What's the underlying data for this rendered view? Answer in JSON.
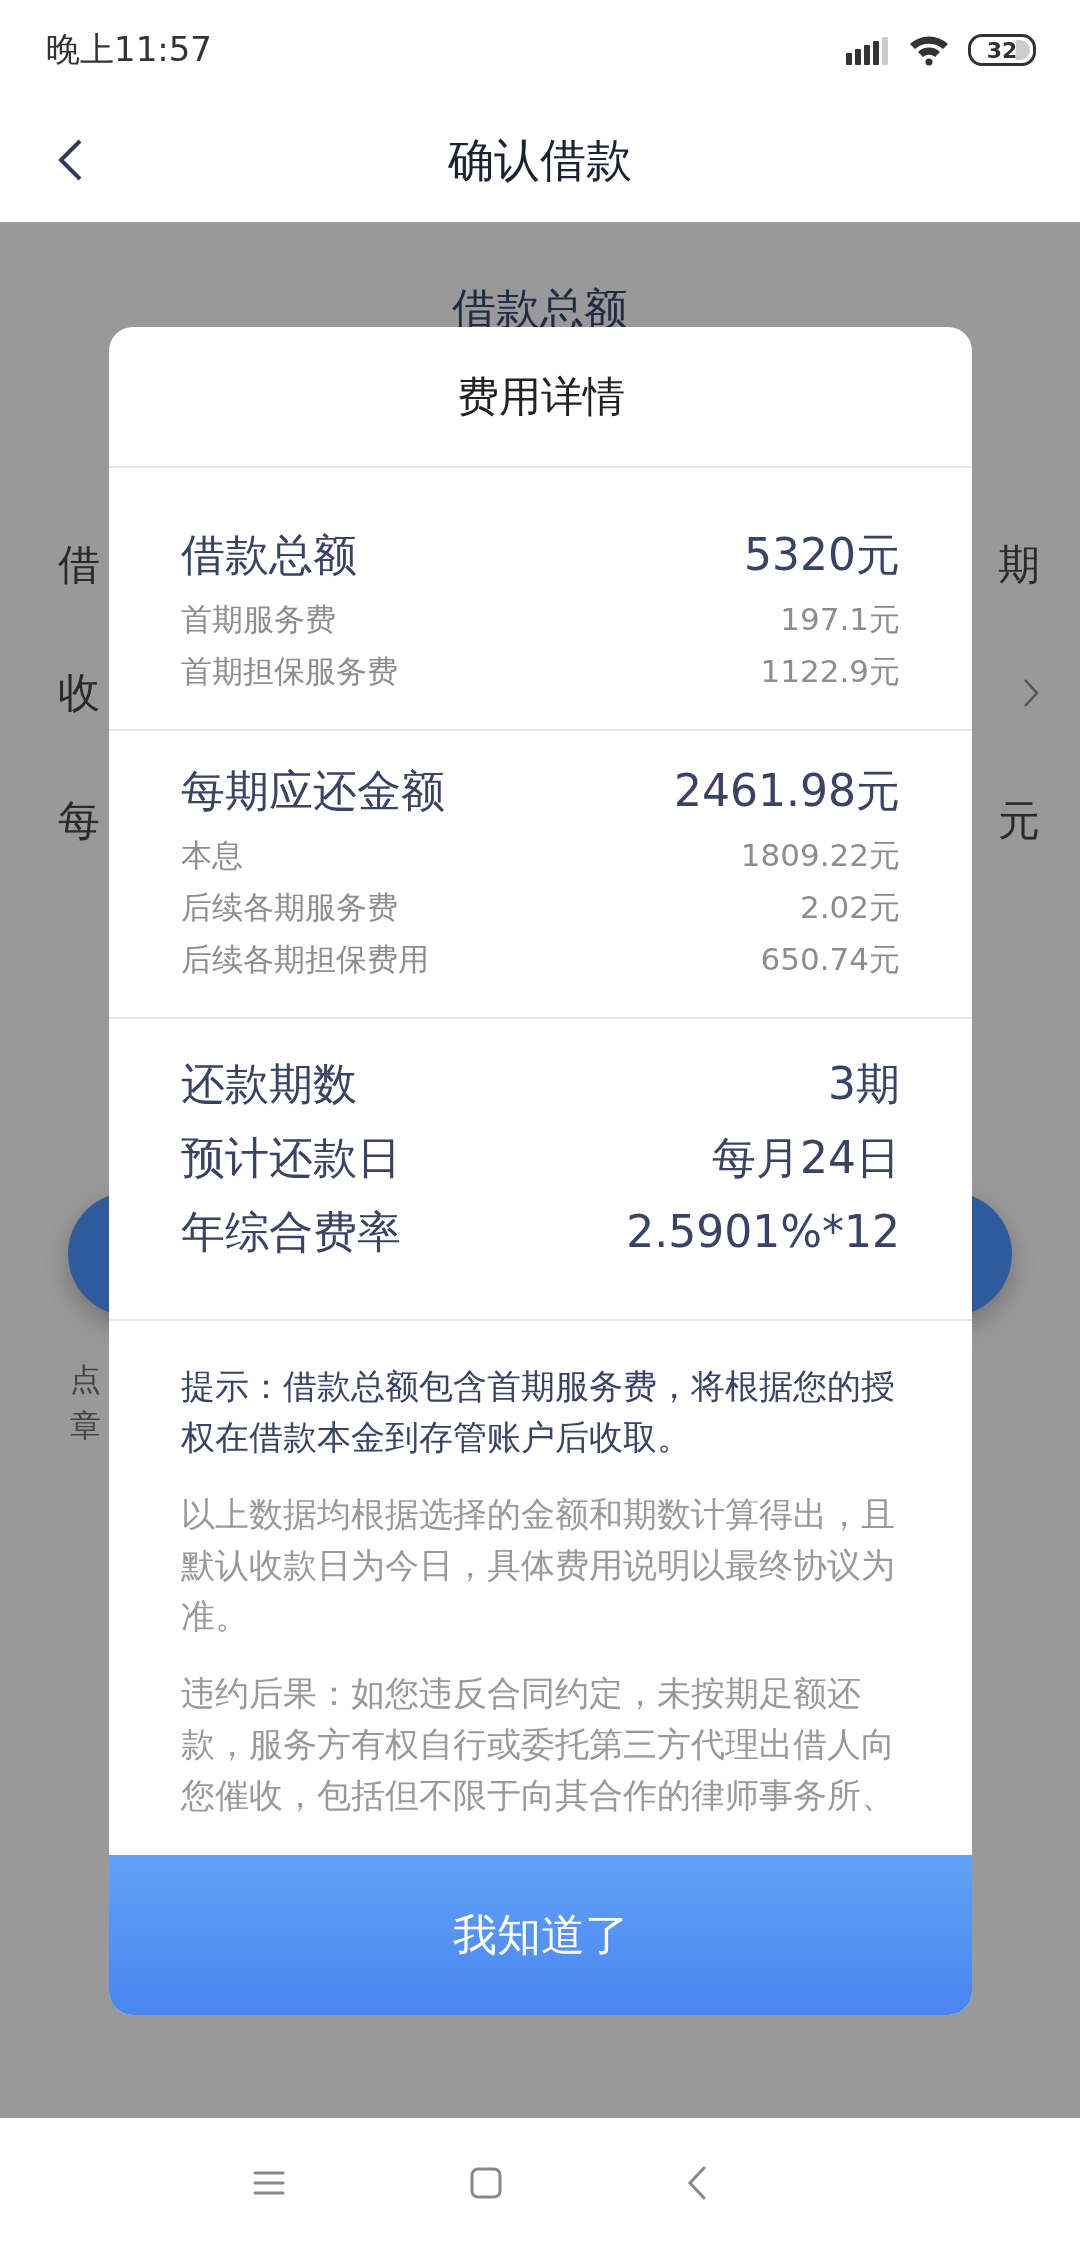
{
  "status_bar": {
    "time": "晚上11:57",
    "battery": "32"
  },
  "header": {
    "title": "确认借款"
  },
  "background": {
    "heading": "借款总额",
    "rows": [
      {
        "kind": "text",
        "label": "借",
        "value": "期"
      },
      {
        "kind": "link",
        "label": "收"
      },
      {
        "kind": "text",
        "label": "每",
        "value": "元"
      }
    ],
    "notes": [
      "点",
      "章"
    ]
  },
  "dialog": {
    "title": "费用详情",
    "sections": [
      {
        "rows": [
          {
            "kind": "main",
            "label": "借款总额",
            "value": "5320元"
          },
          {
            "kind": "sub",
            "label": "首期服务费",
            "value": "197.1元"
          },
          {
            "kind": "sub",
            "label": "首期担保服务费",
            "value": "1122.9元"
          }
        ]
      },
      {
        "rows": [
          {
            "kind": "main",
            "label": "每期应还金额",
            "value": "2461.98元"
          },
          {
            "kind": "sub",
            "label": "本息",
            "value": "1809.22元"
          },
          {
            "kind": "sub",
            "label": "后续各期服务费",
            "value": "2.02元"
          },
          {
            "kind": "sub",
            "label": "后续各期担保费用",
            "value": "650.74元"
          }
        ]
      },
      {
        "rows": [
          {
            "kind": "plain",
            "label": "还款期数",
            "value": "3期"
          },
          {
            "kind": "plain",
            "label": "预计还款日",
            "value": "每月24日"
          },
          {
            "kind": "plain",
            "label": "年综合费率",
            "value": "2.5901%*12"
          }
        ]
      }
    ],
    "paragraphs": [
      {
        "kind": "hint",
        "text": "提示：借款总额包含首期服务费，将根据您的授权在借款本金到存管账户后收取。"
      },
      {
        "kind": "note",
        "text": "以上数据均根据选择的金额和期数计算得出，且默认收款日为今日，具体费用说明以最终协议为准。"
      },
      {
        "kind": "note",
        "text": "违约后果：如您违反合同约定，未按期足额还款，服务方有权自行或委托第三方代理出借人向您催收，包括但不限于向其合作的律师事务所、"
      }
    ],
    "button": "我知道了"
  }
}
